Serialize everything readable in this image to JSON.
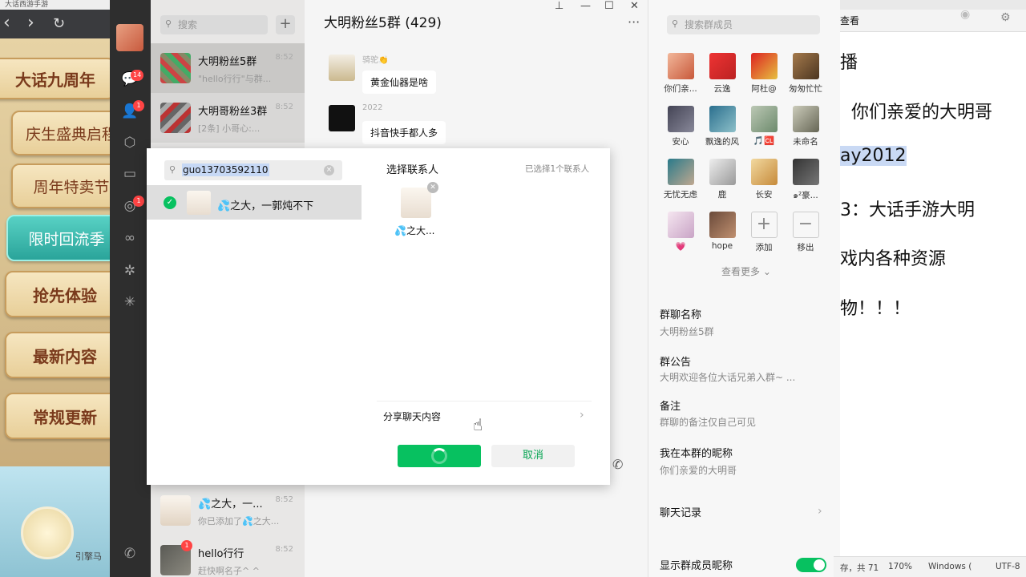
{
  "game": {
    "top_text": "大话西游手游",
    "nav": {
      "back": "‹",
      "forward": "›",
      "reload": "↻"
    },
    "title_button": "大话九周年",
    "menu": [
      {
        "label": "庆生盛典启程",
        "selected": false
      },
      {
        "label": "周年特卖节",
        "selected": false
      },
      {
        "label": "限时回流季",
        "selected": true
      },
      {
        "label": "抢先体验",
        "selected": false
      },
      {
        "label": "最新内容",
        "selected": false
      },
      {
        "label": "常规更新",
        "selected": false
      }
    ],
    "bottom_text": "引擎马"
  },
  "sidebar": {
    "chat_badge": "14",
    "contacts_badge": "1",
    "moments_badge": "1",
    "icons": [
      "chat-icon",
      "contacts-icon",
      "box-icon",
      "folder-icon",
      "moments-icon",
      "channels-icon",
      "miniprogram-icon",
      "sparkle-icon",
      "phone-icon"
    ]
  },
  "chatlist": {
    "search_placeholder": "搜索",
    "add_label": "+",
    "items": [
      {
        "name": "大明粉丝5群",
        "time": "8:52",
        "preview": "\"hello行行\"与群...",
        "badge": ""
      },
      {
        "name": "大明哥粉丝3群",
        "time": "8:52",
        "preview": "[2条] 小哥心:...",
        "badge": "•"
      },
      {
        "name": "💦之大，一...",
        "time": "8:52",
        "preview": "你已添加了💦之大...",
        "badge": ""
      },
      {
        "name": "hello行行",
        "time": "8:52",
        "preview": "赶快啊名子^ ^",
        "badge": "1"
      }
    ]
  },
  "chat": {
    "title": "大明粉丝5群 (429)",
    "window_controls": {
      "pin": "⊥",
      "min": "—",
      "max": "☐",
      "close": "✕"
    },
    "more": "···",
    "messages": [
      {
        "sender": "骑驼👏",
        "text": "黄金仙器是啥"
      },
      {
        "sender": "2022",
        "text": "抖音快手都人多"
      }
    ]
  },
  "group": {
    "search_placeholder": "搜索群成员",
    "members": [
      "你们亲...",
      "云逸",
      "阿杜@",
      "匆匆忙忙",
      "安心",
      "飘逸的风",
      "🎵🆑",
      "未命名",
      "无忧无虑",
      "鹿",
      "长安",
      "๑²豪...",
      "💗",
      "hope"
    ],
    "add_label": "添加",
    "remove_label": "移出",
    "more_label": "查看更多",
    "fields": [
      {
        "label": "群聊名称",
        "value": "大明粉丝5群"
      },
      {
        "label": "群公告",
        "value": "大明欢迎各位大话兄弟入群~ ..."
      },
      {
        "label": "备注",
        "value": "群聊的备注仅自己可见"
      },
      {
        "label": "我在本群的昵称",
        "value": "你们亲爱的大明哥"
      }
    ],
    "chat_history": "聊天记录",
    "show_nickname": "显示群成员昵称",
    "show_nickname_on": true
  },
  "doc": {
    "menu_label": "查看",
    "lines": [
      "播",
      "你们亲爱的大明哥",
      "ay2012",
      "3：大话手游大明",
      "戏内各种资源",
      "物！！！"
    ],
    "status": {
      "pos": "存，共 71",
      "zoom": "170%",
      "eol": "Windows (",
      "enc": "UTF-8"
    }
  },
  "modal": {
    "search_value": "guo13703592110",
    "clear": "×",
    "result_name": "💦之大，一郭炖不下",
    "title": "选择联系人",
    "selected_count": "已选择1个联系人",
    "selected_name": "💦之大...",
    "share_label": "分享聊天内容",
    "cancel_label": "取消"
  },
  "colors": {
    "accent": "#07c160",
    "badge": "#ff4444",
    "game_selected": "#2aa49a"
  }
}
